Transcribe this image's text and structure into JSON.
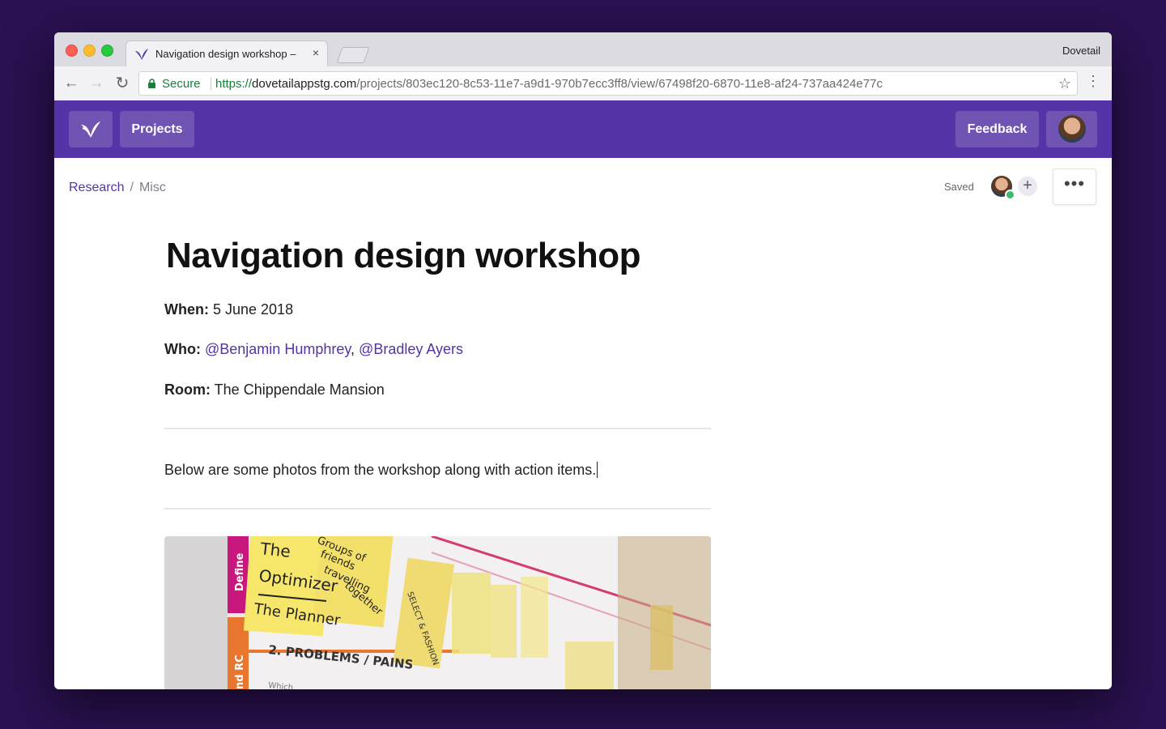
{
  "browser": {
    "tab_title": "Navigation design workshop –",
    "tab_close": "×",
    "profile_name": "Dovetail",
    "secure_label": "Secure",
    "url_scheme": "https://",
    "url_host": "dovetailappstg.com",
    "url_path": "/projects/803ec120-8c53-11e7-a9d1-970b7ecc3ff8/view/67498f20-6870-11e8-af24-737aa424e77c",
    "icons": [
      "back-icon",
      "forward-icon",
      "reload-icon",
      "lock-icon",
      "star-icon",
      "menu-icon"
    ]
  },
  "header": {
    "projects_label": "Projects",
    "feedback_label": "Feedback",
    "brand_color": "#5434a6"
  },
  "breadcrumb": {
    "parent": "Research",
    "separator": "/",
    "current": "Misc"
  },
  "status": {
    "saved_label": "Saved",
    "add_label": "+",
    "more_label": "•••"
  },
  "doc": {
    "title": "Navigation design workshop",
    "when_label": "When:",
    "when_value": " 5 June 2018",
    "who_label": "Who:",
    "who_mention_1": "@Benjamin Humphrey",
    "who_sep": ",",
    "who_mention_2": "@Bradley Ayers",
    "room_label": "Room:",
    "room_value": " The Chippendale Mansion",
    "body": "Below are some photos from the workshop along with action items.",
    "photo_notes": {
      "side_top": "Define",
      "side_bottom": "nd RC",
      "note_1a": "The",
      "note_1b": "Optimizer",
      "note_1c": "The Planner",
      "note_2a": "Groups of",
      "note_2b": "friends",
      "note_2c": "travelling",
      "note_2d": "together",
      "note_3": "SELECT & FASHION",
      "heading": "2. PROBLEMS / PAINS",
      "small": "Which..."
    }
  }
}
